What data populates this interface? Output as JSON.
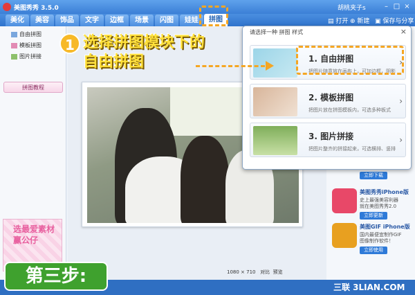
{
  "window": {
    "title": "美图秀秀 3.5.0",
    "user": "胡桃夹子s",
    "minimize": "–",
    "maximize": "□",
    "close": "×"
  },
  "tabs": [
    {
      "label": "美化"
    },
    {
      "label": "美容"
    },
    {
      "label": "饰品"
    },
    {
      "label": "文字"
    },
    {
      "label": "边框"
    },
    {
      "label": "场景"
    },
    {
      "label": "闪图"
    },
    {
      "label": "娃娃"
    },
    {
      "label": "拼图"
    }
  ],
  "toolbar": {
    "open": "打开",
    "new": "新建",
    "save_share": "保存与分享"
  },
  "sidebar": {
    "items": [
      {
        "label": "自由拼图"
      },
      {
        "label": "模板拼图"
      },
      {
        "label": "图片拼接"
      }
    ],
    "tutorial": "拼图教程",
    "ad_text": "选最爱素材 赢公仔"
  },
  "status": {
    "size": "1080 × 710",
    "compare": "对比",
    "preview": "预览"
  },
  "popup": {
    "header": "请选择一种 拼图 样式",
    "close": "×",
    "options": [
      {
        "title": "1. 自由拼图",
        "desc": "把图片随意放在画布上，可加边框，阴影"
      },
      {
        "title": "2. 模板拼图",
        "desc": "把图片放在拼图模板内，可选多种板式"
      },
      {
        "title": "3. 图片拼接",
        "desc": "把图片整齐的拼接起来，可选横排、竖排"
      }
    ]
  },
  "right_apps": [
    {
      "name": "",
      "d1": "",
      "d2": "",
      "btn": "立即下载"
    },
    {
      "name": "美图秀秀iPhone版",
      "d1": "史上最强美容利器",
      "d2": "就在美图秀秀2.0",
      "btn": "立即更新"
    },
    {
      "name": "美图GIF iPhone版",
      "d1": "国内最便宜制作GIF",
      "d2": "图像制作软件！",
      "btn": "立即使用"
    }
  ],
  "overlay": {
    "step_number": "1",
    "instruction_line1": "选择拼图模块下的",
    "instruction_line2": "自由拼图",
    "step_label": "第三步:",
    "watermark": "三联 3LIAN.COM"
  },
  "colors": {
    "accent": "#2f73cc",
    "highlight": "#f5a623",
    "step_green": "#3fa12e",
    "overlay_text": "#ffe03a"
  }
}
